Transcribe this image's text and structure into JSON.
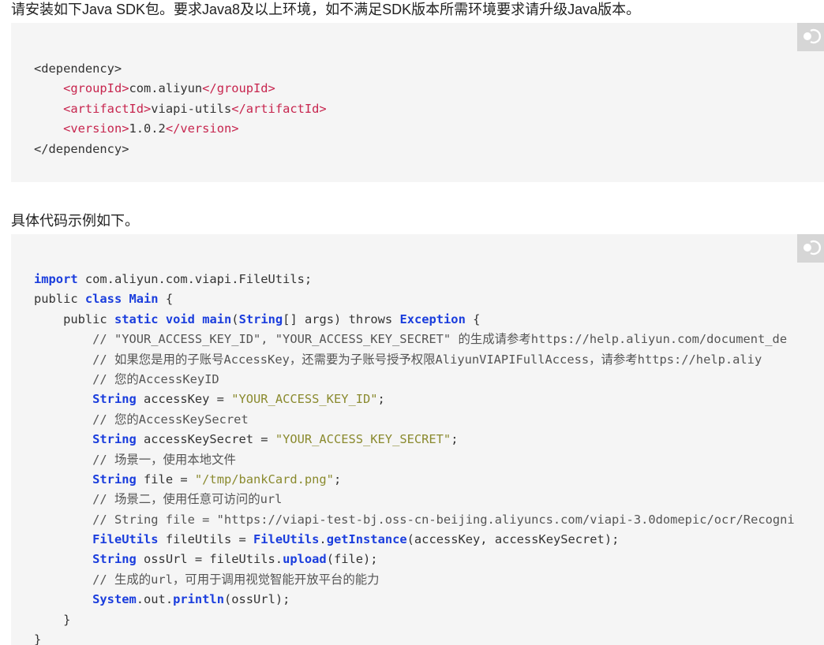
{
  "intro_text": "请安装如下Java SDK包。要求Java8及以上环境，如不满足SDK版本所需环境要求请升级Java版本。",
  "example_text": "具体代码示例如下。",
  "colors": {
    "code_bg": "#f5f5f5",
    "tag": "#c7254e",
    "keyword": "#1a3ddd",
    "string": "#8a8a2e",
    "comment": "#555555",
    "copy_button_bg": "#d6d6d6"
  },
  "icons": {
    "copy_button": "copy-icon"
  },
  "xml_block": {
    "lines": [
      {
        "indent": "",
        "parts": [
          {
            "t": "pl",
            "v": "<dependency>"
          }
        ]
      },
      {
        "indent": "    ",
        "parts": [
          {
            "t": "tag",
            "v": "<groupId>"
          },
          {
            "t": "pl",
            "v": "com.aliyun"
          },
          {
            "t": "tag",
            "v": "</groupId>"
          }
        ]
      },
      {
        "indent": "    ",
        "parts": [
          {
            "t": "tag",
            "v": "<artifactId>"
          },
          {
            "t": "pl",
            "v": "viapi-utils"
          },
          {
            "t": "tag",
            "v": "</artifactId>"
          }
        ]
      },
      {
        "indent": "    ",
        "parts": [
          {
            "t": "tag",
            "v": "<version>"
          },
          {
            "t": "pl",
            "v": "1.0.2"
          },
          {
            "t": "tag",
            "v": "</version>"
          }
        ]
      },
      {
        "indent": "",
        "parts": [
          {
            "t": "pl",
            "v": "</dependency>"
          }
        ]
      }
    ]
  },
  "java_block": {
    "lines": [
      {
        "indent": "",
        "parts": [
          {
            "t": "kw",
            "v": "import"
          },
          {
            "t": "pl",
            "v": " com.aliyun.com.viapi.FileUtils;"
          }
        ]
      },
      {
        "indent": "",
        "parts": [
          {
            "t": "pl",
            "v": "public "
          },
          {
            "t": "kw",
            "v": "class"
          },
          {
            "t": "pl",
            "v": " "
          },
          {
            "t": "ty",
            "v": "Main"
          },
          {
            "t": "pl",
            "v": " {"
          }
        ]
      },
      {
        "indent": "    ",
        "parts": [
          {
            "t": "pl",
            "v": "public "
          },
          {
            "t": "kw",
            "v": "static"
          },
          {
            "t": "pl",
            "v": " "
          },
          {
            "t": "kw",
            "v": "void"
          },
          {
            "t": "pl",
            "v": " "
          },
          {
            "t": "fn",
            "v": "main"
          },
          {
            "t": "pl",
            "v": "("
          },
          {
            "t": "ty",
            "v": "String"
          },
          {
            "t": "pl",
            "v": "[] args) throws "
          },
          {
            "t": "ty",
            "v": "Exception"
          },
          {
            "t": "pl",
            "v": " {"
          }
        ]
      },
      {
        "indent": "        ",
        "parts": [
          {
            "t": "com",
            "v": "// \"YOUR_ACCESS_KEY_ID\", \"YOUR_ACCESS_KEY_SECRET\" 的生成请参考https://help.aliyun.com/document_de"
          }
        ]
      },
      {
        "indent": "        ",
        "parts": [
          {
            "t": "com",
            "v": "// 如果您是用的子账号AccessKey，还需要为子账号授予权限AliyunVIAPIFullAccess，请参考https://help.aliy"
          }
        ]
      },
      {
        "indent": "        ",
        "parts": [
          {
            "t": "com",
            "v": "// 您的AccessKeyID"
          }
        ]
      },
      {
        "indent": "        ",
        "parts": [
          {
            "t": "ty",
            "v": "String"
          },
          {
            "t": "pl",
            "v": " accessKey = "
          },
          {
            "t": "str",
            "v": "\"YOUR_ACCESS_KEY_ID\""
          },
          {
            "t": "pl",
            "v": ";"
          }
        ]
      },
      {
        "indent": "        ",
        "parts": [
          {
            "t": "com",
            "v": "// 您的AccessKeySecret"
          }
        ]
      },
      {
        "indent": "        ",
        "parts": [
          {
            "t": "ty",
            "v": "String"
          },
          {
            "t": "pl",
            "v": " accessKeySecret = "
          },
          {
            "t": "str",
            "v": "\"YOUR_ACCESS_KEY_SECRET\""
          },
          {
            "t": "pl",
            "v": ";"
          }
        ]
      },
      {
        "indent": "        ",
        "parts": [
          {
            "t": "com",
            "v": "// 场景一，使用本地文件"
          }
        ]
      },
      {
        "indent": "        ",
        "parts": [
          {
            "t": "ty",
            "v": "String"
          },
          {
            "t": "pl",
            "v": " file = "
          },
          {
            "t": "str",
            "v": "\"/tmp/bankCard.png\""
          },
          {
            "t": "pl",
            "v": ";"
          }
        ]
      },
      {
        "indent": "        ",
        "parts": [
          {
            "t": "com",
            "v": "// 场景二，使用任意可访问的url"
          }
        ]
      },
      {
        "indent": "        ",
        "parts": [
          {
            "t": "com",
            "v": "// String file = \"https://viapi-test-bj.oss-cn-beijing.aliyuncs.com/viapi-3.0domepic/ocr/Recogni"
          }
        ]
      },
      {
        "indent": "        ",
        "parts": [
          {
            "t": "ty",
            "v": "FileUtils"
          },
          {
            "t": "pl",
            "v": " fileUtils = "
          },
          {
            "t": "ty",
            "v": "FileUtils"
          },
          {
            "t": "pl",
            "v": "."
          },
          {
            "t": "fn",
            "v": "getInstance"
          },
          {
            "t": "pl",
            "v": "(accessKey, accessKeySecret);"
          }
        ]
      },
      {
        "indent": "        ",
        "parts": [
          {
            "t": "ty",
            "v": "String"
          },
          {
            "t": "pl",
            "v": " ossUrl = fileUtils."
          },
          {
            "t": "fn",
            "v": "upload"
          },
          {
            "t": "pl",
            "v": "(file);"
          }
        ]
      },
      {
        "indent": "        ",
        "parts": [
          {
            "t": "com",
            "v": "// 生成的url，可用于调用视觉智能开放平台的能力"
          }
        ]
      },
      {
        "indent": "        ",
        "parts": [
          {
            "t": "ty",
            "v": "System"
          },
          {
            "t": "pl",
            "v": ".out."
          },
          {
            "t": "fn",
            "v": "println"
          },
          {
            "t": "pl",
            "v": "(ossUrl);"
          }
        ]
      },
      {
        "indent": "    ",
        "parts": [
          {
            "t": "pl",
            "v": "}"
          }
        ]
      },
      {
        "indent": "",
        "parts": [
          {
            "t": "pl",
            "v": "}"
          }
        ]
      }
    ]
  }
}
